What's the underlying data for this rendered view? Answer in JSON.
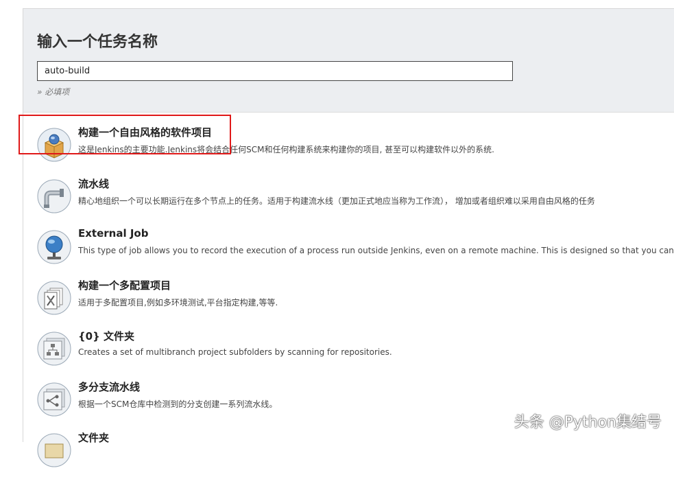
{
  "header": {
    "title": "输入一个任务名称",
    "input_value": "auto-build",
    "required_hint": "» 必填项"
  },
  "items": [
    {
      "name": "构建一个自由风格的软件项目",
      "desc": "这是Jenkins的主要功能.Jenkins将会结合任何SCM和任何构建系统来构建你的项目, 甚至可以构建软件以外的系统.",
      "icon": "freestyle-box-icon"
    },
    {
      "name": "流水线",
      "desc": "精心地组织一个可以长期运行在多个节点上的任务。适用于构建流水线（更加正式地应当称为工作流）， 增加或者组织难以采用自由风格的任务",
      "icon": "pipeline-icon"
    },
    {
      "name": "External Job",
      "desc": "This type of job allows you to record the execution of a process run outside Jenkins, even on a remote machine. This is designed so that you can",
      "icon": "globe-icon"
    },
    {
      "name": "构建一个多配置项目",
      "desc": "适用于多配置项目,例如多环境测试,平台指定构建,等等.",
      "icon": "multi-config-icon"
    },
    {
      "name": "{0} 文件夹",
      "desc": "Creates a set of multibranch project subfolders by scanning for repositories.",
      "icon": "org-folder-icon"
    },
    {
      "name": "多分支流水线",
      "desc": "根据一个SCM仓库中检测到的分支创建一系列流水线。",
      "icon": "multibranch-icon"
    },
    {
      "name": "文件夹",
      "desc": "",
      "icon": "folder-icon"
    }
  ],
  "watermark": "头条 @Python集结号",
  "colors": {
    "highlight": "#e01818",
    "header_bg": "#eceef1"
  }
}
